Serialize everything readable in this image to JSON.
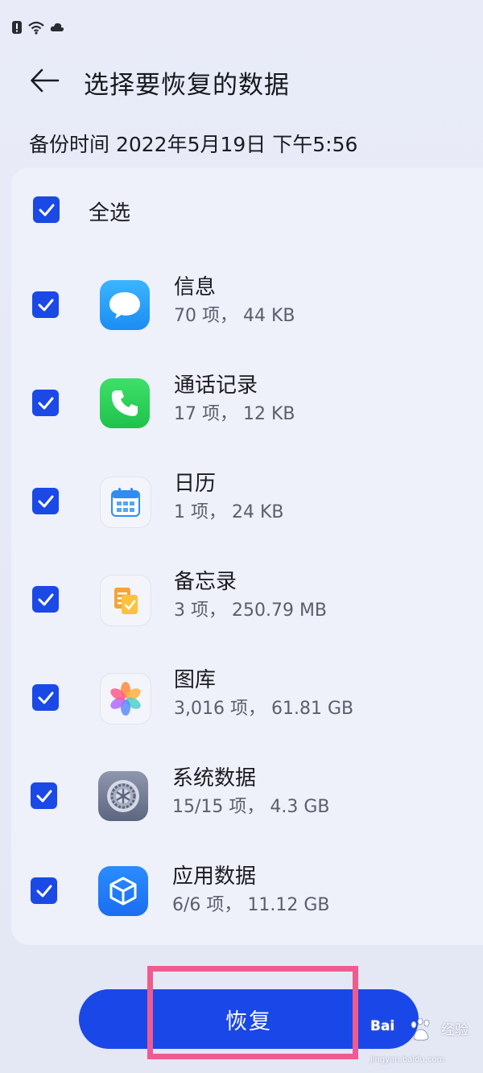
{
  "header": {
    "title": "选择要恢复的数据"
  },
  "backup": {
    "time": "备份时间 2022年5月19日 下午5:56"
  },
  "select_all": {
    "label": "全选",
    "checked": true
  },
  "items": [
    {
      "name": "信息",
      "meta": "70 项， 44 KB",
      "icon": "messages-icon",
      "checked": true
    },
    {
      "name": "通话记录",
      "meta": "17 项， 12 KB",
      "icon": "phone-icon",
      "checked": true
    },
    {
      "name": "日历",
      "meta": "1 项， 24 KB",
      "icon": "calendar-icon",
      "checked": true
    },
    {
      "name": "备忘录",
      "meta": "3 项， 250.79 MB",
      "icon": "notes-icon",
      "checked": true
    },
    {
      "name": "图库",
      "meta": "3,016 项， 61.81 GB",
      "icon": "gallery-icon",
      "checked": true
    },
    {
      "name": "系统数据",
      "meta": "15/15 项， 4.3 GB",
      "icon": "settings-icon",
      "checked": true
    },
    {
      "name": "应用数据",
      "meta": "6/6 项， 11.12 GB",
      "icon": "app-data-icon",
      "checked": true
    }
  ],
  "footer": {
    "restore_label": "恢复"
  },
  "watermark": {
    "brand": "Bai",
    "label": "经验",
    "url": "jingyan.baidu.com"
  },
  "colors": {
    "accent": "#1a47e8",
    "highlight": "#ef5b8f",
    "background": "#e8ebf7"
  }
}
